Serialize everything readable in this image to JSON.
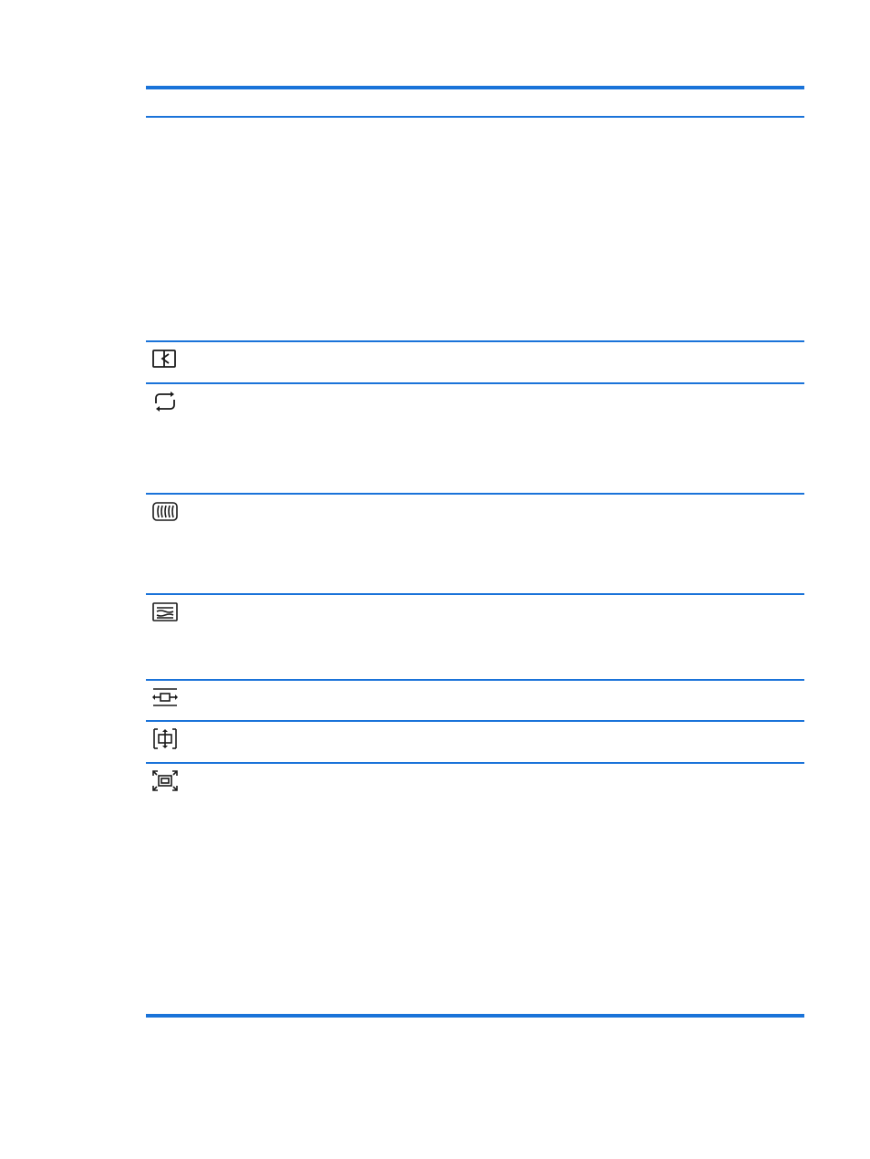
{
  "colors": {
    "rule": "#1a73d9",
    "icon": "#1a1a1a",
    "background": "#ffffff"
  },
  "table": {
    "rows": [
      {
        "icon": "auto-adjustment-icon"
      },
      {
        "icon": "reset-cycle-icon"
      },
      {
        "icon": "clock-icon"
      },
      {
        "icon": "clock-phase-icon"
      },
      {
        "icon": "horizontal-position-icon"
      },
      {
        "icon": "vertical-position-icon"
      },
      {
        "icon": "custom-scaling-icon"
      }
    ]
  }
}
